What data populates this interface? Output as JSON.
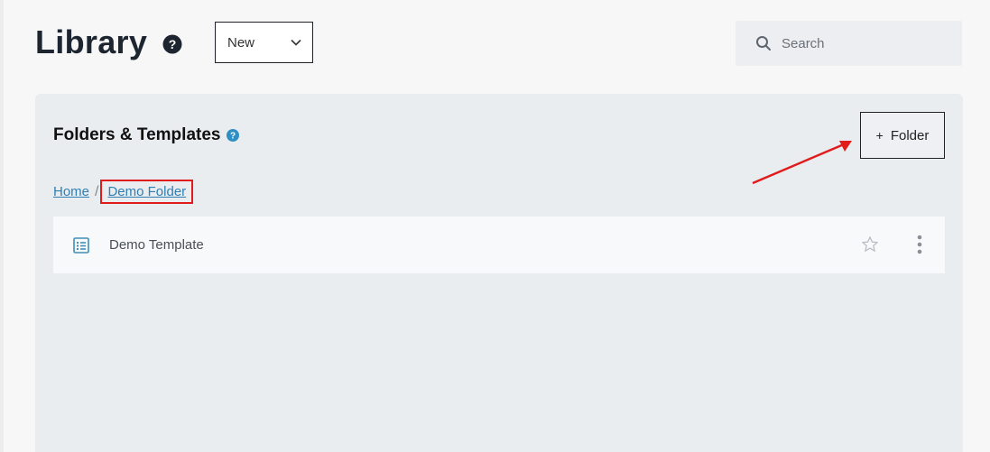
{
  "header": {
    "title": "Library",
    "new_select_value": "New",
    "search_placeholder": "Search"
  },
  "panel": {
    "title": "Folders & Templates",
    "add_folder_label": "Folder",
    "add_folder_prefix": "+"
  },
  "breadcrumb": {
    "separator": "/",
    "items": [
      "Home",
      "Demo Folder"
    ]
  },
  "list": {
    "items": [
      {
        "label": "Demo Template"
      }
    ]
  },
  "colors": {
    "accent_link": "#2f7fb4",
    "annotation_red": "#e01b1b",
    "panel_bg": "#eaedf0"
  },
  "icons": [
    "help-icon",
    "chevron-down-icon",
    "search-icon",
    "template-icon",
    "star-icon",
    "kebab-menu-icon"
  ]
}
